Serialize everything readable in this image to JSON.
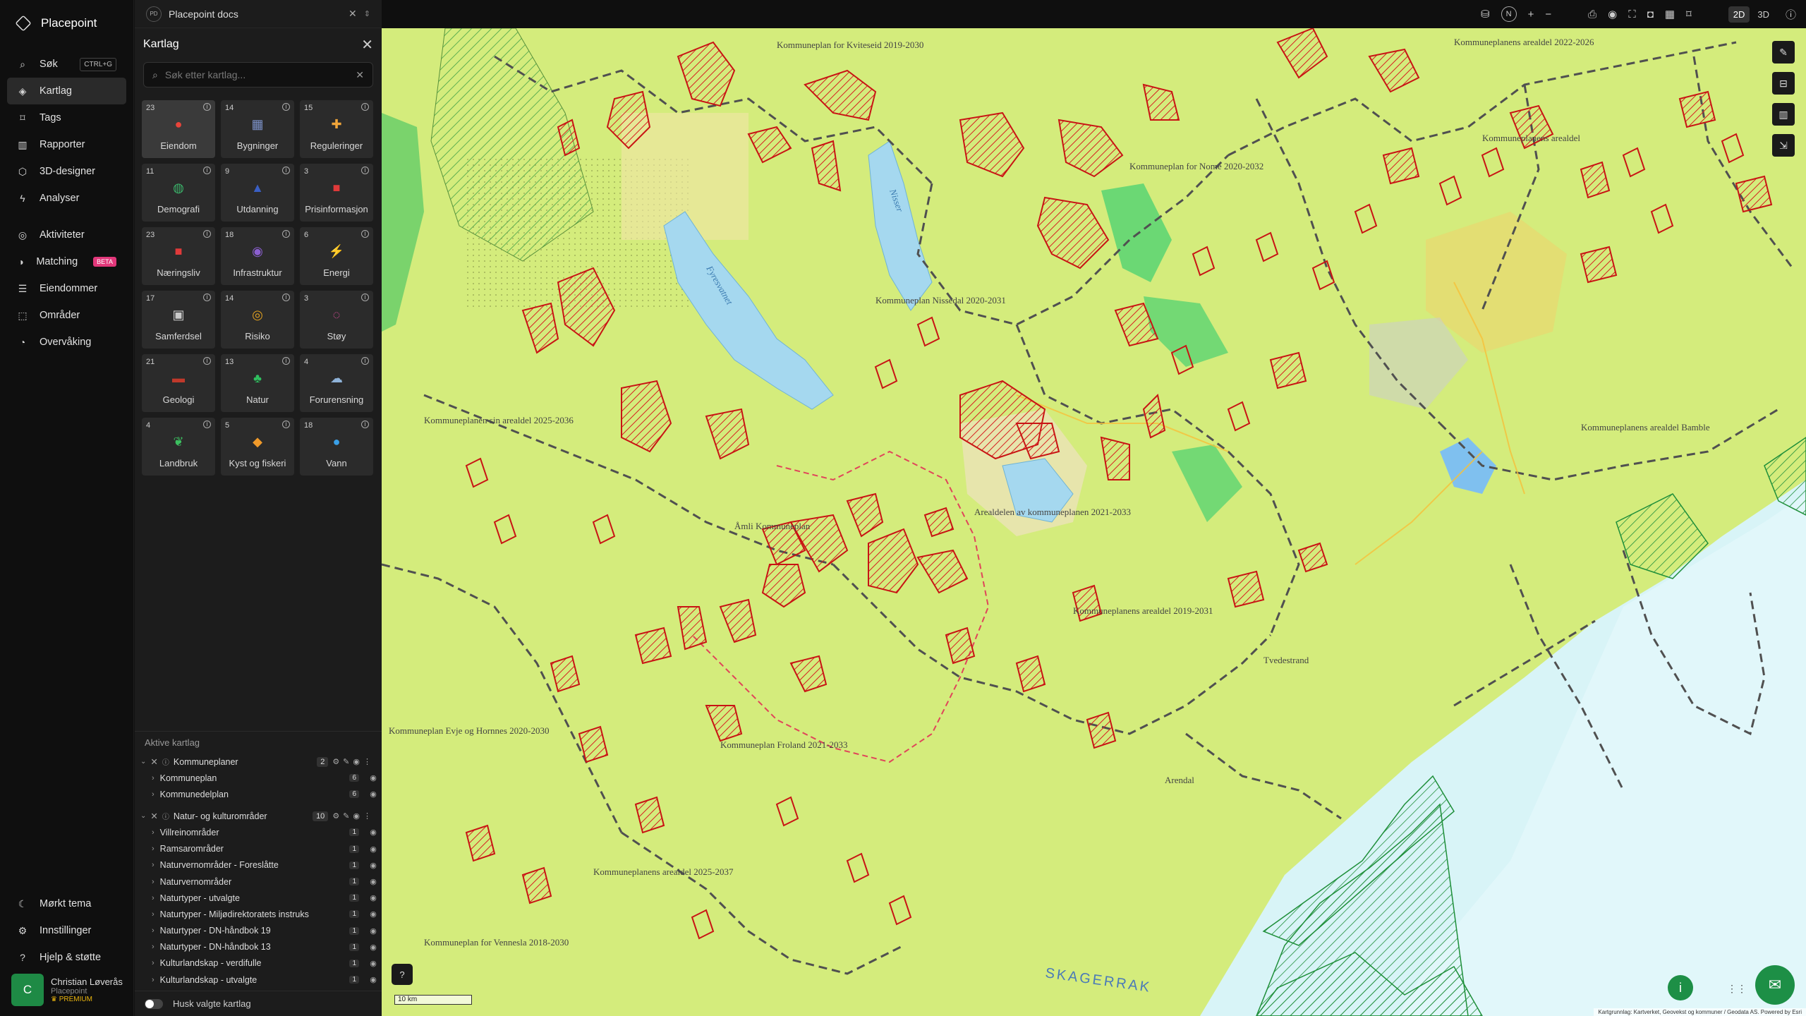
{
  "brand": {
    "name": "Placepoint"
  },
  "nav": {
    "items": [
      {
        "label": "Søk",
        "shortcut": "CTRL+G",
        "icon": "search-icon"
      },
      {
        "label": "Kartlag",
        "icon": "layers-icon"
      },
      {
        "label": "Tags",
        "icon": "bookmark-icon"
      },
      {
        "label": "Rapporter",
        "icon": "report-icon"
      },
      {
        "label": "3D-designer",
        "icon": "cube-icon"
      },
      {
        "label": "Analyser",
        "icon": "bolt-icon"
      }
    ],
    "items2": [
      {
        "label": "Aktiviteter",
        "icon": "activity-icon"
      },
      {
        "label": "Matching",
        "badge": "BETA",
        "icon": "matching-icon"
      },
      {
        "label": "Eiendommer",
        "icon": "list-icon"
      },
      {
        "label": "Områder",
        "icon": "area-icon"
      },
      {
        "label": "Overvåking",
        "icon": "monitor-icon"
      }
    ],
    "bottom": [
      {
        "label": "Mørkt tema",
        "icon": "moon-icon"
      },
      {
        "label": "Innstillinger",
        "icon": "gear-icon"
      },
      {
        "label": "Hjelp & støtte",
        "icon": "help-icon"
      }
    ]
  },
  "user": {
    "initial": "C",
    "name": "Christian Løverås",
    "org": "Placepoint",
    "plan": "PREMIUM"
  },
  "topbar": {
    "badge": "PD",
    "title": "Placepoint docs"
  },
  "panel": {
    "title": "Kartlag",
    "search_placeholder": "Søk etter kartlag...",
    "tiles": [
      {
        "count": "23",
        "label": "Eiendom",
        "color": "#e8443a",
        "glyph": "●"
      },
      {
        "count": "14",
        "label": "Bygninger",
        "color": "#7a8fc4",
        "glyph": "▦"
      },
      {
        "count": "15",
        "label": "Reguleringer",
        "color": "#f0a53a",
        "glyph": "✚"
      },
      {
        "count": "11",
        "label": "Demografi",
        "color": "#3bb36a",
        "glyph": "◍"
      },
      {
        "count": "9",
        "label": "Utdanning",
        "color": "#3a5fc4",
        "glyph": "▲"
      },
      {
        "count": "3",
        "label": "Prisinformasjon",
        "color": "#e03a3a",
        "glyph": "■"
      },
      {
        "count": "23",
        "label": "Næringsliv",
        "color": "#e03a3a",
        "glyph": "■"
      },
      {
        "count": "18",
        "label": "Infrastruktur",
        "color": "#8b5fd0",
        "glyph": "◉"
      },
      {
        "count": "6",
        "label": "Energi",
        "color": "#f2c21b",
        "glyph": "⚡"
      },
      {
        "count": "17",
        "label": "Samferdsel",
        "color": "#c9c9c9",
        "glyph": "▣"
      },
      {
        "count": "14",
        "label": "Risiko",
        "color": "#e0a020",
        "glyph": "◎"
      },
      {
        "count": "3",
        "label": "Støy",
        "color": "#e84fa0",
        "glyph": "◌"
      },
      {
        "count": "21",
        "label": "Geologi",
        "color": "#c0392b",
        "glyph": "▬"
      },
      {
        "count": "13",
        "label": "Natur",
        "color": "#2fbf5f",
        "glyph": "♣"
      },
      {
        "count": "4",
        "label": "Forurensning",
        "color": "#8fb3d9",
        "glyph": "☁"
      },
      {
        "count": "4",
        "label": "Landbruk",
        "color": "#3cc060",
        "glyph": "❦"
      },
      {
        "count": "5",
        "label": "Kyst og fiskeri",
        "color": "#f09a2a",
        "glyph": "◆"
      },
      {
        "count": "18",
        "label": "Vann",
        "color": "#3aa0e8",
        "glyph": "●"
      }
    ]
  },
  "active_layers": {
    "title": "Aktive kartlag",
    "groups": [
      {
        "name": "Kommuneplaner",
        "count": "2",
        "rows": [
          {
            "label": "Kommuneplan",
            "count": "6"
          },
          {
            "label": "Kommunedelplan",
            "count": "6"
          }
        ]
      },
      {
        "name": "Natur- og kulturområder",
        "count": "10",
        "rows": [
          {
            "label": "Villreinområder",
            "count": "1"
          },
          {
            "label": "Ramsarområder",
            "count": "1"
          },
          {
            "label": "Naturvernområder - Foreslåtte",
            "count": "1"
          },
          {
            "label": "Naturvernområder",
            "count": "1"
          },
          {
            "label": "Naturtyper - utvalgte",
            "count": "1"
          },
          {
            "label": "Naturtyper - Miljødirektoratets instruks",
            "count": "1"
          },
          {
            "label": "Naturtyper - DN-håndbok 19",
            "count": "1"
          },
          {
            "label": "Naturtyper - DN-håndbok 13",
            "count": "1"
          },
          {
            "label": "Kulturlandskap - verdifulle",
            "count": "1"
          },
          {
            "label": "Kulturlandskap - utvalgte",
            "count": "1"
          }
        ]
      }
    ],
    "remember_label": "Husk valgte kartlag"
  },
  "mapbar": {
    "compass": "N",
    "mode_2d": "2D",
    "mode_3d": "3D",
    "active_mode": "2D"
  },
  "map": {
    "scale": "10 km",
    "attribution": "Kartgrunnlag: Kartverket, Geovekst og kommuner / Geodata AS. Powered by Esri",
    "sea_label": "SKAGERRAK",
    "labels": [
      "Kommuneplan for Kviteseid 2019-2030",
      "Kommuneplanens arealdel 2022-2026",
      "Kommuneplan for Nome 2020-2032",
      "Kommuneplanens arealdel",
      "Kommuneplan Nissedal 2020-2031",
      "Kommuneplanen sin arealdel 2025-2036",
      "Åmli Kommuneplan",
      "Arealdelen av kommuneplanen 2021-2033",
      "Kommuneplanens arealdel 2019-2031",
      "Kommuneplan Froland 2021-2033",
      "Kommuneplan Evje og Hornnes 2020-2030",
      "Kommuneplanens arealdel 2025-2037",
      "Kommuneplan for Vennesla 2018-2030",
      "Kommuneplanens arealdel Bamble",
      "Fyresvatnet",
      "Nisser",
      "Tvedestrand",
      "Arendal"
    ]
  }
}
